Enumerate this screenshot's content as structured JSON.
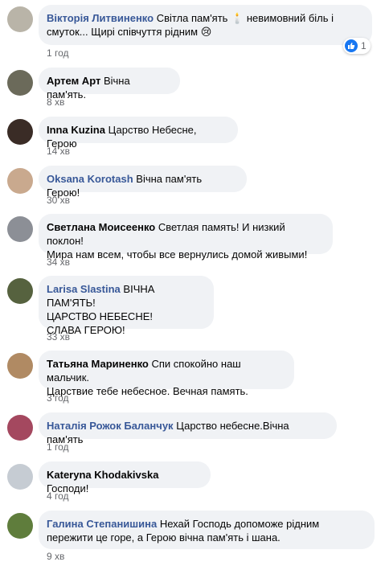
{
  "comments": [
    {
      "author": "Вікторія Литвиненко",
      "author_style": "blue",
      "text": "Світла пам'ять 🕯️ невимовний біль і\nсмуток... Щирі співчуття рідним 😢",
      "time": "1 год",
      "reactions": {
        "count": "1",
        "icon": "like-icon"
      },
      "avatar_color": "#b9b4a8"
    },
    {
      "author": "Артем Арт",
      "author_style": "dark",
      "text": "Вічна пам'ять.",
      "time": "8 хв",
      "avatar_color": "#6b6a5a"
    },
    {
      "author": "Inna Kuzina",
      "author_style": "dark",
      "text": "Царство Небесне, Герою",
      "time": "14 хв",
      "avatar_color": "#3a2c26"
    },
    {
      "author": "Oksana Korotash",
      "author_style": "blue",
      "text": "Вічна пам'ять Герою!",
      "time": "30 хв",
      "avatar_color": "#c9a98e"
    },
    {
      "author": "Светлана Моисеенко",
      "author_style": "dark",
      "text": "Светлая память! И низкий поклон!\nМира нам всем, чтобы все вернулись домой живыми!",
      "time": "34 хв",
      "avatar_color": "#8c8f96"
    },
    {
      "author": "Larisa Slastina",
      "author_style": "blue",
      "text": "ВІЧНА ПАМ'ЯТЬ!\nЦАРСТВО НЕБЕСНЕ!\nСЛАВА ГЕРОЮ!",
      "time": "33 хв",
      "avatar_color": "#56623f"
    },
    {
      "author": "Татьяна Мариненко",
      "author_style": "dark",
      "text": "Спи спокойно наш мальчик.\nЦарствие тебе небесное. Вечная память.",
      "time": "3 год",
      "avatar_color": "#b08a63"
    },
    {
      "author": "Наталія Рожок Баланчук",
      "author_style": "blue",
      "text": "Царство небесне.Вічна пам'ять",
      "time": "1 год",
      "avatar_color": "#a4485f"
    },
    {
      "author": "Kateryna Khodakivska",
      "author_style": "dark",
      "text": "Господи!",
      "time": "4 год",
      "avatar_color": "#c6ccd3"
    },
    {
      "author": "Галина Степанишина",
      "author_style": "blue",
      "text": "Нехай Господь допоможе рідним\nпережити це горе, а Герою вічна пам'ять і шана.",
      "time": "9 хв",
      "avatar_color": "#5f7d3c"
    }
  ]
}
